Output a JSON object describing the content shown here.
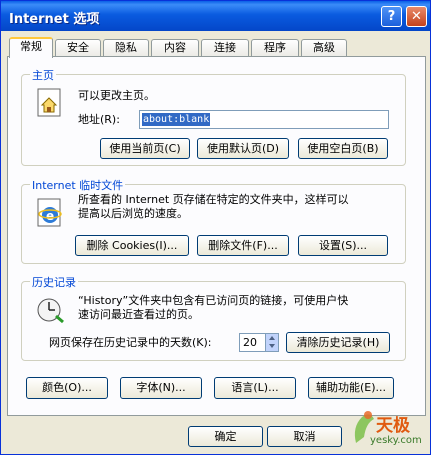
{
  "window": {
    "title": "Internet 选项",
    "help_btn": "?",
    "close_btn": "✕"
  },
  "tabs": [
    {
      "label": "常规"
    },
    {
      "label": "安全"
    },
    {
      "label": "隐私"
    },
    {
      "label": "内容"
    },
    {
      "label": "连接"
    },
    {
      "label": "程序"
    },
    {
      "label": "高级"
    }
  ],
  "homepage": {
    "group_title": "主页",
    "desc": "可以更改主页。",
    "address_label": "地址(R):",
    "address_value": "about:blank",
    "btn_current": "使用当前页(C)",
    "btn_default": "使用默认页(D)",
    "btn_blank": "使用空白页(B)"
  },
  "temp_files": {
    "group_title": "Internet 临时文件",
    "desc_line1": "所查看的 Internet 页存储在特定的文件夹中，这样可以",
    "desc_line2": "提高以后浏览的速度。",
    "btn_delete_cookies": "删除 Cookies(I)...",
    "btn_delete_files": "删除文件(F)...",
    "btn_settings": "设置(S)..."
  },
  "history": {
    "group_title": "历史记录",
    "desc_line1": "“History”文件夹中包含有已访问页的链接，可使用户快",
    "desc_line2": "速访问最近查看过的页。",
    "days_label": "网页保存在历史记录中的天数(K):",
    "days_value": "20",
    "btn_clear": "清除历史记录(H)"
  },
  "bottom_buttons": {
    "colors": "颜色(O)...",
    "fonts": "字体(N)...",
    "languages": "语言(L)...",
    "accessibility": "辅助功能(E)..."
  },
  "footer": {
    "ok": "确定",
    "cancel": "取消"
  },
  "watermark": {
    "text": "天极",
    "sub": "yesky.com"
  }
}
